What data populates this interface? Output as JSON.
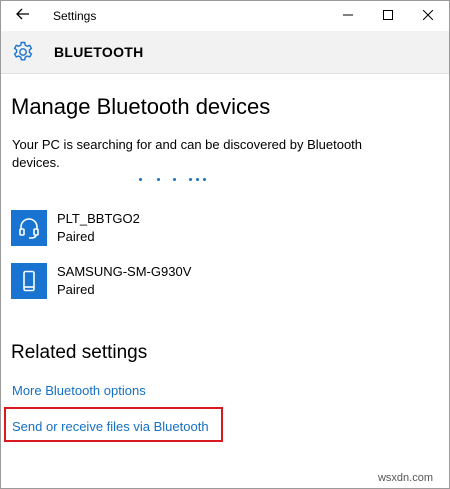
{
  "window": {
    "app_title": "Settings",
    "controls": {
      "minimize": "minimize-icon",
      "maximize": "maximize-icon",
      "close": "close-icon"
    }
  },
  "header": {
    "icon": "gear-icon",
    "title": "BLUETOOTH"
  },
  "main": {
    "title": "Manage Bluetooth devices",
    "description": "Your PC is searching for and can be discovered by Bluetooth devices.",
    "devices": [
      {
        "name": "PLT_BBTGO2",
        "status": "Paired",
        "icon": "headset-icon"
      },
      {
        "name": "SAMSUNG-SM-G930V",
        "status": "Paired",
        "icon": "phone-icon"
      }
    ]
  },
  "related": {
    "title": "Related settings",
    "links": [
      "More Bluetooth options",
      "Send or receive files via Bluetooth"
    ]
  },
  "watermark": "wsxdn.com",
  "colors": {
    "accent": "#1874d0",
    "link": "#1570c4",
    "highlight": "#d9181f",
    "header_bg": "#f2f2f2"
  }
}
